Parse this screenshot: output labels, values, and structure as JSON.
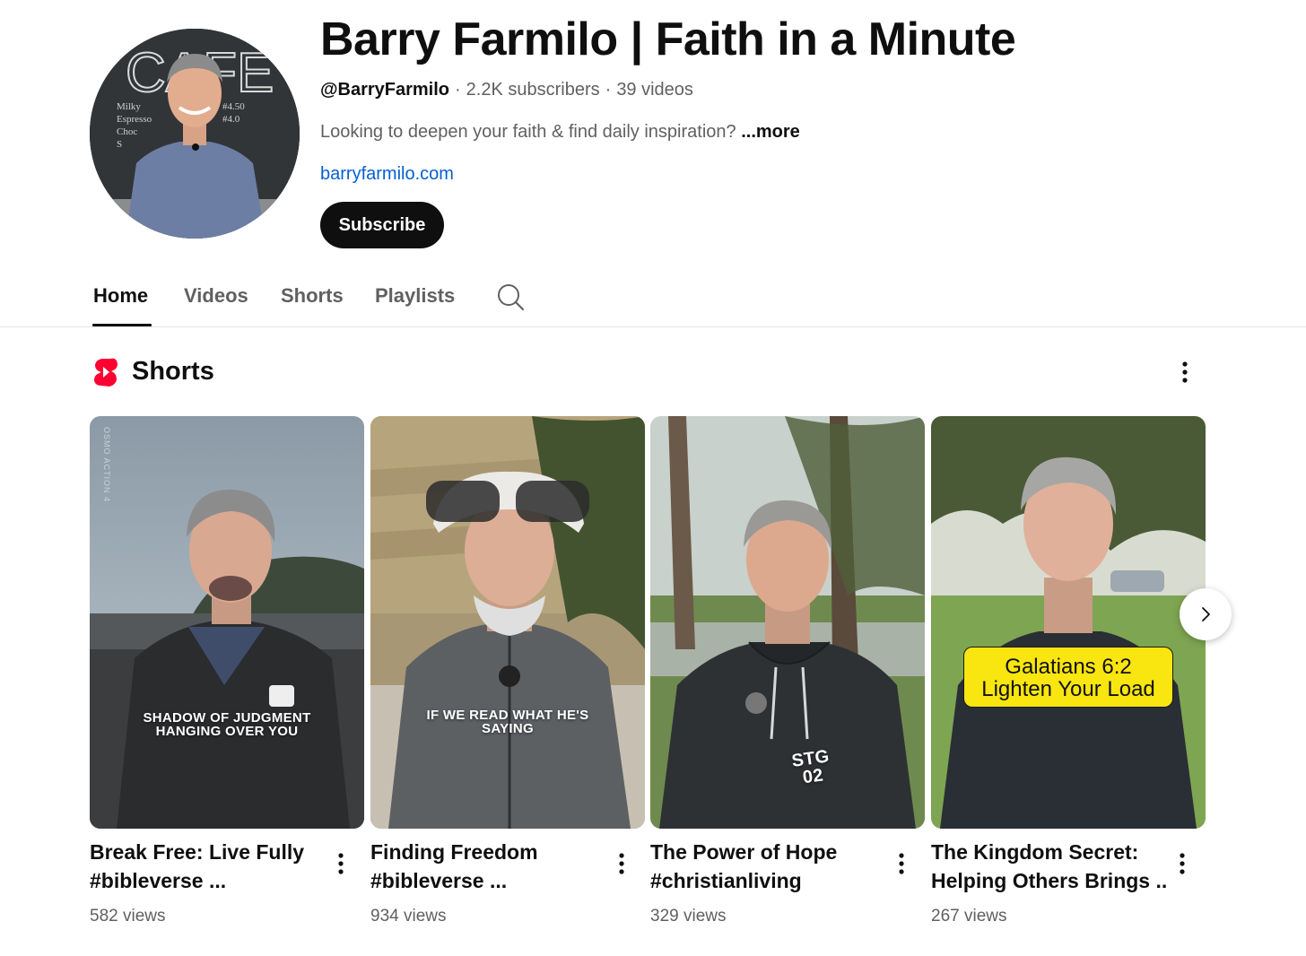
{
  "channel": {
    "name": "Barry Farmilo | Faith in a Minute",
    "handle": "@BarryFarmilo",
    "subscribers": "2.2K subscribers",
    "videos": "39 videos",
    "separator": "·",
    "description": "Looking to deepen your faith & find daily inspiration?",
    "more_label": "...more",
    "link": "barryfarmilo.com",
    "subscribe_label": "Subscribe",
    "avatar_board_text": "CAFE"
  },
  "tabs": [
    {
      "label": "Home",
      "active": true
    },
    {
      "label": "Videos",
      "active": false
    },
    {
      "label": "Shorts",
      "active": false
    },
    {
      "label": "Playlists",
      "active": false
    }
  ],
  "shelf": {
    "title": "Shorts",
    "icon": "youtube-shorts-icon",
    "accent_color": "#ff0033",
    "items": [
      {
        "title_line1": "Break Free: Live Fully",
        "title_line2": "#bibleverse ...",
        "views": "582 views",
        "thumb_caption": "SHADOW OF JUDGMENT\nHANGING OVER YOU",
        "thumb_watermark": "OSMO ACTION 4"
      },
      {
        "title_line1": "Finding Freedom",
        "title_line2": "#bibleverse ...",
        "views": "934 views",
        "thumb_caption": "IF WE READ WHAT HE'S\nSAYING"
      },
      {
        "title_line1": "The Power of Hope",
        "title_line2": "#christianliving",
        "views": "329 views",
        "thumb_shirt_text": "STG\n02"
      },
      {
        "title_line1": "The Kingdom Secret:",
        "title_line2": "Helping Others Brings ...",
        "views": "267 views",
        "thumb_label": "Galatians 6:2\nLighten Your Load"
      }
    ]
  }
}
